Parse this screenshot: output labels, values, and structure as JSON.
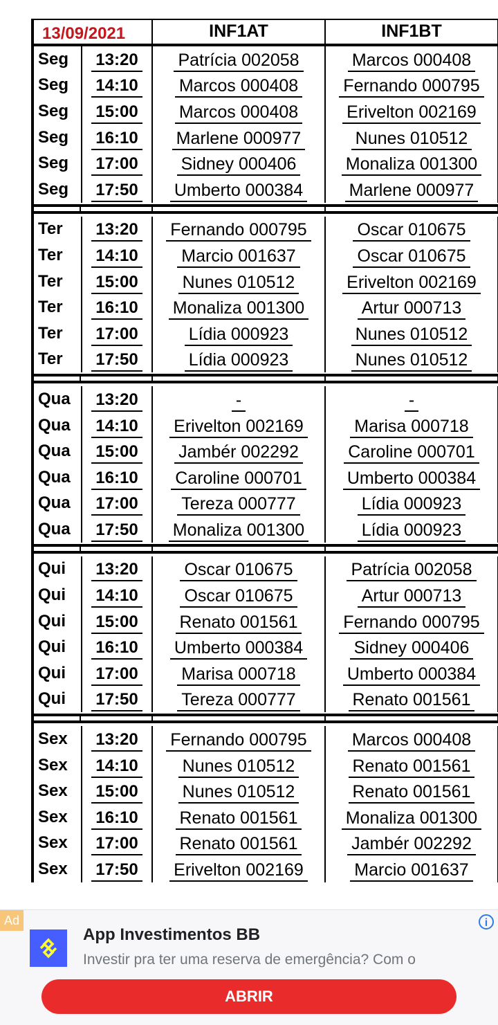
{
  "header": {
    "date": "13/09/2021",
    "col1": "INF1AT",
    "col2": "INF1BT"
  },
  "days": [
    {
      "rows": [
        {
          "day": "Seg",
          "time": "13:20",
          "inf1at": "Patrícia 002058",
          "inf1bt": "Marcos 000408"
        },
        {
          "day": "Seg",
          "time": "14:10",
          "inf1at": "Marcos 000408",
          "inf1bt": "Fernando 000795"
        },
        {
          "day": "Seg",
          "time": "15:00",
          "inf1at": "Marcos 000408",
          "inf1bt": "Erivelton 002169"
        },
        {
          "day": "Seg",
          "time": "16:10",
          "inf1at": "Marlene 000977",
          "inf1bt": "Nunes 010512"
        },
        {
          "day": "Seg",
          "time": "17:00",
          "inf1at": "Sidney 000406",
          "inf1bt": "Monaliza 001300"
        },
        {
          "day": "Seg",
          "time": "17:50",
          "inf1at": "Umberto 000384",
          "inf1bt": "Marlene 000977"
        }
      ]
    },
    {
      "rows": [
        {
          "day": "Ter",
          "time": "13:20",
          "inf1at": "Fernando 000795",
          "inf1bt": "Oscar 010675"
        },
        {
          "day": "Ter",
          "time": "14:10",
          "inf1at": "Marcio 001637",
          "inf1bt": "Oscar 010675"
        },
        {
          "day": "Ter",
          "time": "15:00",
          "inf1at": "Nunes 010512",
          "inf1bt": "Erivelton 002169"
        },
        {
          "day": "Ter",
          "time": "16:10",
          "inf1at": "Monaliza 001300",
          "inf1bt": "Artur 000713"
        },
        {
          "day": "Ter",
          "time": "17:00",
          "inf1at": "Lídia 000923",
          "inf1bt": "Nunes 010512"
        },
        {
          "day": "Ter",
          "time": "17:50",
          "inf1at": "Lídia 000923",
          "inf1bt": "Nunes 010512"
        }
      ]
    },
    {
      "rows": [
        {
          "day": "Qua",
          "time": "13:20",
          "inf1at": "-",
          "inf1bt": "-"
        },
        {
          "day": "Qua",
          "time": "14:10",
          "inf1at": "Erivelton 002169",
          "inf1bt": "Marisa 000718"
        },
        {
          "day": "Qua",
          "time": "15:00",
          "inf1at": "Jambér 002292",
          "inf1bt": "Caroline 000701"
        },
        {
          "day": "Qua",
          "time": "16:10",
          "inf1at": "Caroline 000701",
          "inf1bt": "Umberto 000384"
        },
        {
          "day": "Qua",
          "time": "17:00",
          "inf1at": "Tereza 000777",
          "inf1bt": "Lídia 000923"
        },
        {
          "day": "Qua",
          "time": "17:50",
          "inf1at": "Monaliza 001300",
          "inf1bt": "Lídia 000923"
        }
      ]
    },
    {
      "rows": [
        {
          "day": "Qui",
          "time": "13:20",
          "inf1at": "Oscar 010675",
          "inf1bt": "Patrícia 002058"
        },
        {
          "day": "Qui",
          "time": "14:10",
          "inf1at": "Oscar 010675",
          "inf1bt": "Artur 000713"
        },
        {
          "day": "Qui",
          "time": "15:00",
          "inf1at": "Renato 001561",
          "inf1bt": "Fernando 000795"
        },
        {
          "day": "Qui",
          "time": "16:10",
          "inf1at": "Umberto 000384",
          "inf1bt": "Sidney 000406"
        },
        {
          "day": "Qui",
          "time": "17:00",
          "inf1at": "Marisa 000718",
          "inf1bt": "Umberto 000384"
        },
        {
          "day": "Qui",
          "time": "17:50",
          "inf1at": "Tereza 000777",
          "inf1bt": "Renato 001561"
        }
      ]
    },
    {
      "rows": [
        {
          "day": "Sex",
          "time": "13:20",
          "inf1at": "Fernando 000795",
          "inf1bt": "Marcos 000408"
        },
        {
          "day": "Sex",
          "time": "14:10",
          "inf1at": "Nunes 010512",
          "inf1bt": "Renato 001561"
        },
        {
          "day": "Sex",
          "time": "15:00",
          "inf1at": "Nunes 010512",
          "inf1bt": "Renato 001561"
        },
        {
          "day": "Sex",
          "time": "16:10",
          "inf1at": "Renato 001561",
          "inf1bt": "Monaliza 001300"
        },
        {
          "day": "Sex",
          "time": "17:00",
          "inf1at": "Renato 001561",
          "inf1bt": "Jambér 002292"
        },
        {
          "day": "Sex",
          "time": "17:50",
          "inf1at": "Erivelton 002169",
          "inf1bt": "Marcio 001637"
        }
      ]
    }
  ],
  "ad": {
    "badge": "Ad",
    "title": "App Investimentos BB",
    "description": "Investir pra ter uma reserva de emergência? Com o",
    "button": "ABRIR",
    "info_icon": "info-icon",
    "logo_icon": "banco-do-brasil-logo",
    "colors": {
      "logo_bg": "#465eff",
      "logo_fg": "#fcfc30",
      "button_bg": "#ea2b2b",
      "badge_bg": "#f7c67a",
      "date_text": "#c4161c"
    }
  }
}
